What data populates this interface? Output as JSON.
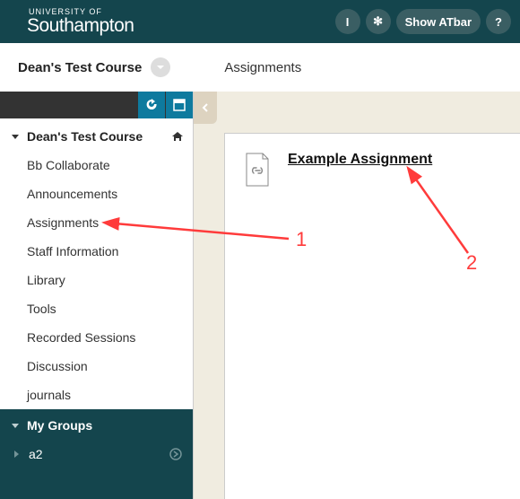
{
  "brand": {
    "top": "UNIVERSITY OF",
    "main": "Southampton"
  },
  "topbar": {
    "info_label": "I",
    "star_label": "✻",
    "atbar_label": "Show ATbar",
    "help_label": "?"
  },
  "breadcrumb": {
    "course": "Dean's Test Course",
    "page": "Assignments"
  },
  "sidebar": {
    "course_title": "Dean's Test Course",
    "items": [
      {
        "label": "Bb Collaborate"
      },
      {
        "label": "Announcements"
      },
      {
        "label": "Assignments"
      },
      {
        "label": "Staff Information"
      },
      {
        "label": "Library"
      },
      {
        "label": "Tools"
      },
      {
        "label": "Recorded Sessions"
      },
      {
        "label": "Discussion"
      },
      {
        "label": "journals"
      }
    ],
    "groups_title": "My Groups",
    "groups": [
      {
        "label": "a2"
      }
    ]
  },
  "content": {
    "assignment_title": "Example Assignment"
  },
  "annotations": {
    "one": "1",
    "two": "2"
  }
}
